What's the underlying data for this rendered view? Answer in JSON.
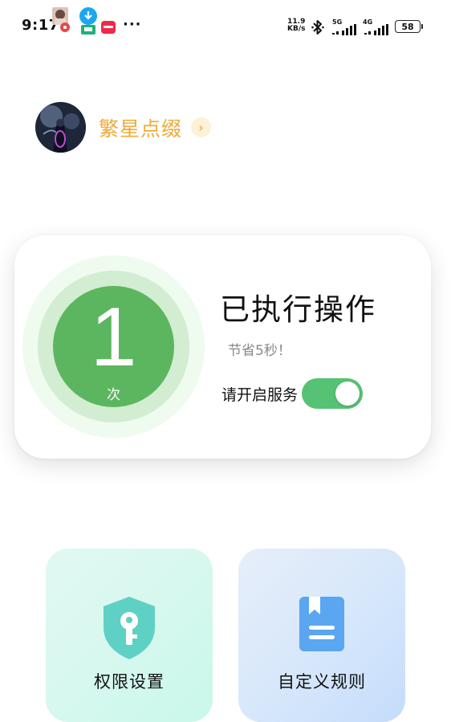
{
  "status_bar": {
    "time": "9:17",
    "more": "···",
    "net_speed_value": "11.9",
    "net_speed_unit": "KB/s",
    "net1": "5G",
    "net2": "4G",
    "battery": "58"
  },
  "profile": {
    "username": "繁星点缀",
    "arrow": "›"
  },
  "stats": {
    "count": "1",
    "unit": "次",
    "title": "已执行操作",
    "subtitle": "节省5秒！",
    "service_label": "请开启服务",
    "service_enabled": true
  },
  "features": [
    {
      "label": "权限设置",
      "icon": "shield-key-icon"
    },
    {
      "label": "自定义规则",
      "icon": "bookmark-book-icon"
    }
  ],
  "colors": {
    "accent_green": "#5cb65f",
    "toggle_green": "#56c274",
    "username_orange": "#f0aa36",
    "icon_teal": "#5fd0c4",
    "icon_blue": "#5aa6f0"
  }
}
